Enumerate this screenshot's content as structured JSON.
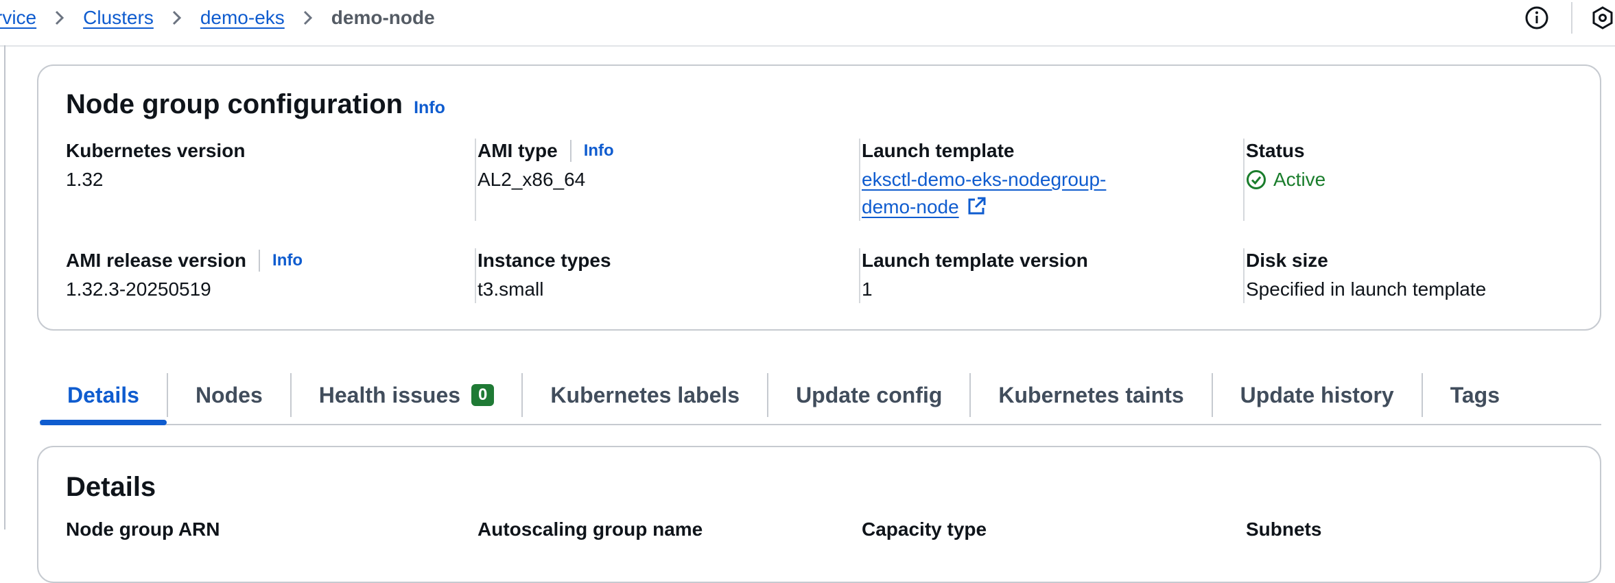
{
  "breadcrumb": {
    "items": [
      "rvice",
      "Clusters",
      "demo-eks"
    ],
    "current": "demo-node"
  },
  "top_icons": [
    "info-circle-icon",
    "settings-hex-icon"
  ],
  "config": {
    "title": "Node group configuration",
    "info": "Info",
    "fields": {
      "k8s_version_label": "Kubernetes version",
      "k8s_version_value": "1.32",
      "ami_type_label": "AMI type",
      "ami_type_info": "Info",
      "ami_type_value": "AL2_x86_64",
      "launch_template_label": "Launch template",
      "launch_template_line1": "eksctl-demo-eks-nodegroup-",
      "launch_template_line2": "demo-node",
      "status_label": "Status",
      "status_value": "Active",
      "ami_release_label": "AMI release version",
      "ami_release_info": "Info",
      "ami_release_value": "1.32.3-20250519",
      "instance_types_label": "Instance types",
      "instance_types_value": "t3.small",
      "lt_version_label": "Launch template version",
      "lt_version_value": "1",
      "disk_size_label": "Disk size",
      "disk_size_value": "Specified in launch template"
    }
  },
  "tabs": {
    "details": "Details",
    "nodes": "Nodes",
    "health": "Health issues",
    "health_count": "0",
    "k8s_labels": "Kubernetes labels",
    "update_config": "Update config",
    "k8s_taints": "Kubernetes taints",
    "update_history": "Update history",
    "tags": "Tags"
  },
  "details": {
    "title": "Details",
    "partial_labels": [
      "Node group ARN",
      "Autoscaling group name",
      "Capacity type",
      "Subnets"
    ]
  },
  "colors": {
    "link": "#0f5ccf",
    "success": "#1a7d2c",
    "badge": "#1f7a35"
  }
}
